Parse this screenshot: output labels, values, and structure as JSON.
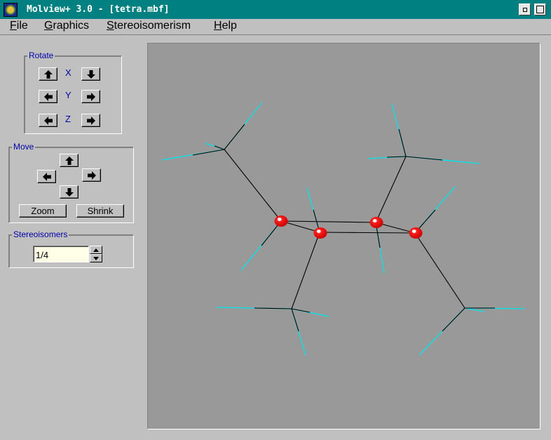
{
  "window": {
    "title": "Molview+ 3.0 - [tetra.mbf]"
  },
  "menu": {
    "file": "File",
    "graphics": "Graphics",
    "stereoisomerism": "Stereoisomerism",
    "help": "Help"
  },
  "rotate": {
    "label": "Rotate",
    "x": "X",
    "y": "Y",
    "z": "Z"
  },
  "move": {
    "label": "Move",
    "zoom": "Zoom",
    "shrink": "Shrink"
  },
  "stereoisomers": {
    "label": "Stereoisomers",
    "value": "1/4"
  },
  "colors": {
    "background": "#999999",
    "bond": "#000000",
    "hydrogen_bond": "#00ffff",
    "atom": "#ff0000",
    "titlebar": "#008080",
    "group_label": "#0000a8"
  },
  "icons": [
    "arrow-up-icon",
    "arrow-down-icon",
    "arrow-left-icon",
    "arrow-right-icon"
  ]
}
